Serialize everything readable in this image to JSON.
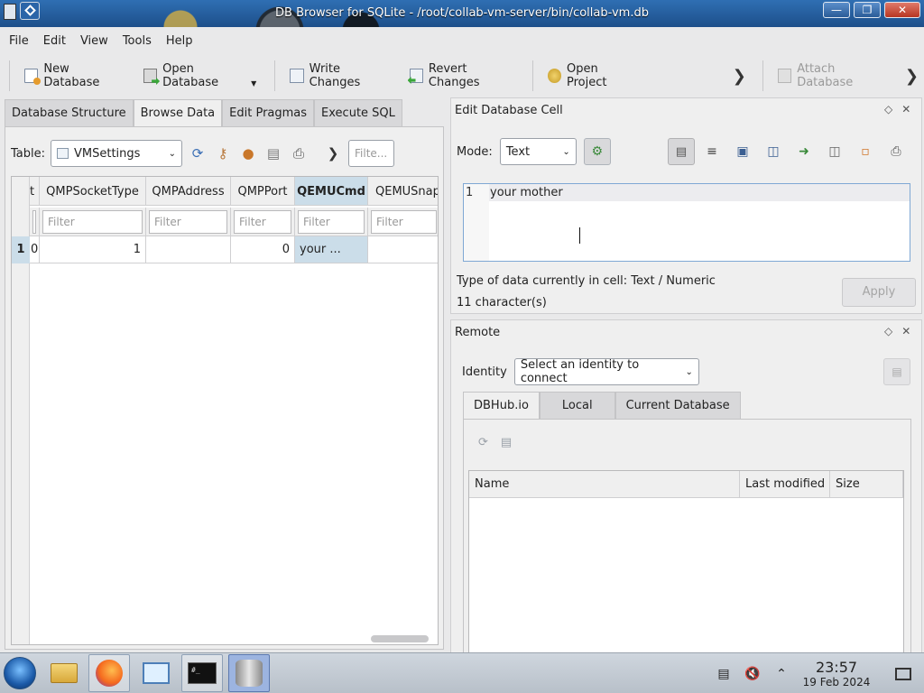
{
  "window": {
    "title": "DB Browser for SQLite - /root/collab-vm-server/bin/collab-vm.db"
  },
  "menu": [
    "File",
    "Edit",
    "View",
    "Tools",
    "Help"
  ],
  "toolbar": {
    "new_database": "New Database",
    "open_database": "Open Database",
    "write_changes": "Write Changes",
    "revert_changes": "Revert Changes",
    "open_project": "Open Project",
    "attach_database": "Attach Database"
  },
  "left_tabs": [
    "Database Structure",
    "Browse Data",
    "Edit Pragmas",
    "Execute SQL"
  ],
  "browse": {
    "table_label": "Table:",
    "table_value": "VMSettings",
    "filter_placeholder": "Filte...",
    "columns": [
      "t",
      "QMPSocketType",
      "QMPAddress",
      "QMPPort",
      "QEMUCmd",
      "QEMUSnap"
    ],
    "filter_text": "Filter",
    "row_number": "1",
    "row": [
      "0",
      "1",
      "",
      "0",
      "your ...",
      ""
    ]
  },
  "edit_cell": {
    "title": "Edit Database Cell",
    "mode_label": "Mode:",
    "mode_value": "Text",
    "line_number": "1",
    "content": "your mother",
    "type_info": "Type of data currently in cell: Text / Numeric",
    "char_count": "11 character(s)",
    "apply": "Apply"
  },
  "remote": {
    "title": "Remote",
    "identity_label": "Identity",
    "identity_value": "Select an identity to connect",
    "tabs": [
      "DBHub.io",
      "Local",
      "Current Database"
    ],
    "columns": [
      "Name",
      "Last modified",
      "Size"
    ]
  },
  "taskbar": {
    "time": "23:57",
    "date": "19 Feb 2024"
  }
}
